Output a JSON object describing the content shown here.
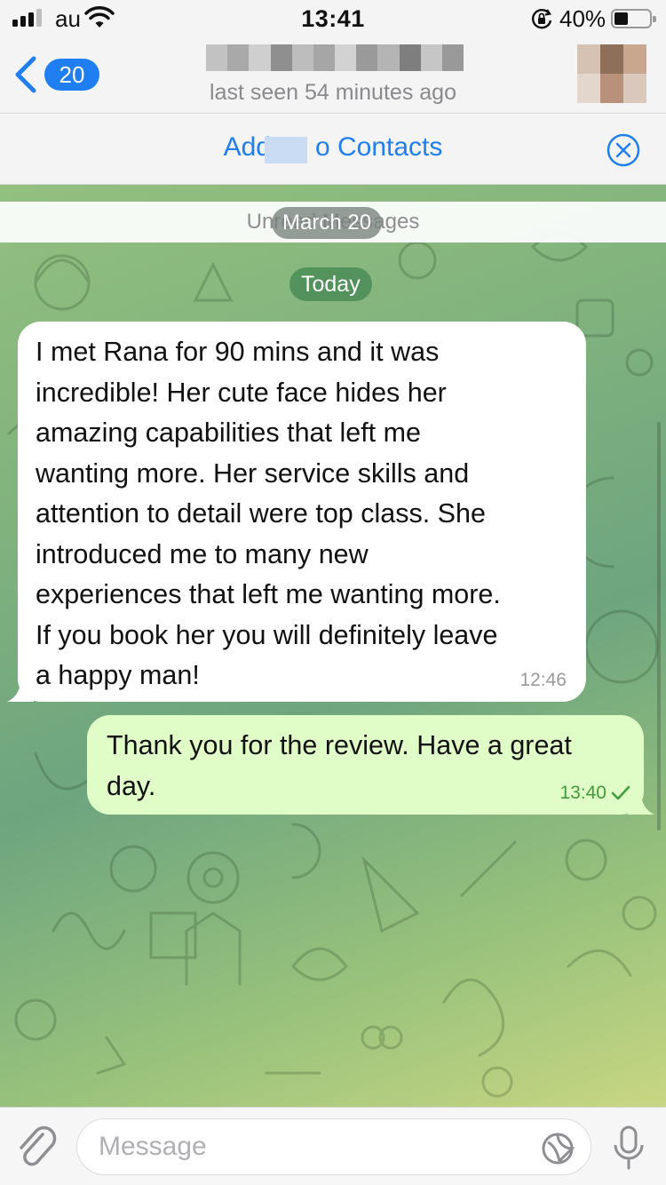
{
  "status_bar": {
    "carrier": "au",
    "time": "13:41",
    "battery_percent": "40%",
    "battery_level": 0.4,
    "signal_bars_filled": 3,
    "signal_bars_total": 4,
    "icons": [
      "signal-icon",
      "wifi-icon",
      "orientation-lock-icon",
      "battery-icon"
    ]
  },
  "nav": {
    "back_badge_count": "20",
    "last_seen": "last seen 54 minutes ago",
    "title_redacted_colors": [
      "#c2c2c2",
      "#a9a9a9",
      "#cfcfcf",
      "#8f8f8f",
      "#bdbdbd",
      "#a6a6a6",
      "#d2d2d2",
      "#9a9a9a",
      "#b4b4b4",
      "#7e7e7e",
      "#c6c6c6",
      "#999999"
    ],
    "avatar_redacted_colors": [
      "#d6c2b3",
      "#8e6f5a",
      "#c9a78f",
      "#e3d6cc",
      "#b7917a",
      "#d9c8bb"
    ]
  },
  "banner": {
    "add_contact_text": "Add      o Contacts",
    "close_icon": "close-circle-icon"
  },
  "chat": {
    "unread_strip_text": "Unread Messages",
    "date_chip": "March 20",
    "today_chip": "Today",
    "messages": [
      {
        "direction": "incoming",
        "text": "I met Rana for 90 mins and it was\nincredible! Her cute face hides her\namazing capabilities that left me\nwanting more. Her service skills and\nattention to detail were top class. She\nintroduced me to many new\nexperiences that left me wanting more.\nIf you book her you will definitely leave\na happy man!",
        "time": "12:46"
      },
      {
        "direction": "outgoing",
        "text": "Thank you for the review. Have a great\nday.",
        "time": "13:40",
        "status_icon": "read-check-icon"
      }
    ]
  },
  "colors": {
    "accent": "#1f7ff0",
    "outgoing_bubble": "#e1fdc7",
    "outgoing_time": "#3f9c3a"
  },
  "input": {
    "placeholder": "Message",
    "value": ""
  }
}
